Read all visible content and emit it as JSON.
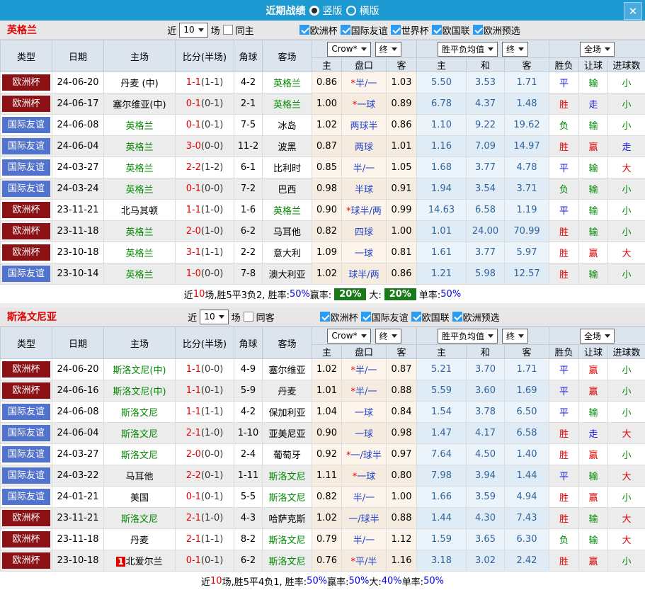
{
  "titlebar": {
    "title": "近期战绩",
    "vertical": "竖版",
    "horizontal": "横版"
  },
  "icons": {
    "close": "✕",
    "check": "✓"
  },
  "labels": {
    "near": "近",
    "matches_suffix": "场"
  },
  "table_header": {
    "cols": [
      "类型",
      "日期",
      "主场",
      "比分(半场)",
      "角球",
      "客场"
    ],
    "sub": [
      "主",
      "盘口",
      "客",
      "主",
      "和",
      "客",
      "胜负",
      "让球",
      "进球数"
    ],
    "selects": {
      "crow": "Crow*",
      "final": "终",
      "wdl": "胜平负均值",
      "final2": "终",
      "scope": "全场"
    }
  },
  "colors": {
    "titlebar_bg": "#1e9ad2",
    "type_colors": {
      "欧洲杯": "#8c1114",
      "国际友谊": "#5273cd"
    },
    "result_colors": {
      "胜": "#dd0000",
      "平": "#1515dd",
      "负": "#008800",
      "赢": "#dd0000",
      "走": "#1515dd",
      "输": "#008800",
      "大": "#dd0000",
      "小": "#008800"
    },
    "team_green": "#008800",
    "score_red": "#e60000",
    "handicap_blue": "#2244cc",
    "wdl_blue": "#31639c",
    "highlight_green": "#1a7a1a"
  },
  "sections": [
    {
      "team": "英格兰",
      "filter": {
        "matches": "10",
        "same_label": "同主",
        "leagues": [
          "欧洲杯",
          "国际友谊",
          "世界杯",
          "欧国联",
          "欧洲预选"
        ]
      },
      "rows": [
        {
          "type": "欧洲杯",
          "date": "24-06-20",
          "home": "丹麦 (中)",
          "hg": false,
          "score": "1-1",
          "half": "(1-1)",
          "corner": "4-2",
          "away": "英格兰",
          "ag": true,
          "o1": "0.86",
          "star": true,
          "hcap": "半/一",
          "o2": "1.03",
          "w": "5.50",
          "d": "3.53",
          "l": "1.71",
          "r1": "平",
          "r2": "输",
          "r3": "小"
        },
        {
          "type": "欧洲杯",
          "date": "24-06-17",
          "home": "塞尔维亚(中)",
          "hg": false,
          "score": "0-1",
          "half": "(0-1)",
          "corner": "2-1",
          "away": "英格兰",
          "ag": true,
          "o1": "1.00",
          "star": true,
          "hcap": "一球",
          "o2": "0.89",
          "w": "6.78",
          "d": "4.37",
          "l": "1.48",
          "r1": "胜",
          "r2": "走",
          "r3": "小"
        },
        {
          "type": "国际友谊",
          "date": "24-06-08",
          "home": "英格兰",
          "hg": true,
          "score": "0-1",
          "half": "(0-1)",
          "corner": "7-5",
          "away": "冰岛",
          "ag": false,
          "o1": "1.02",
          "star": false,
          "hcap": "两球半",
          "o2": "0.86",
          "w": "1.10",
          "d": "9.22",
          "l": "19.62",
          "r1": "负",
          "r2": "输",
          "r3": "小"
        },
        {
          "type": "国际友谊",
          "date": "24-06-04",
          "home": "英格兰",
          "hg": true,
          "score": "3-0",
          "half": "(0-0)",
          "corner": "11-2",
          "away": "波黑",
          "ag": false,
          "o1": "0.87",
          "star": false,
          "hcap": "两球",
          "o2": "1.01",
          "w": "1.16",
          "d": "7.09",
          "l": "14.97",
          "r1": "胜",
          "r2": "赢",
          "r3": "走"
        },
        {
          "type": "国际友谊",
          "date": "24-03-27",
          "home": "英格兰",
          "hg": true,
          "score": "2-2",
          "half": "(1-2)",
          "corner": "6-1",
          "away": "比利时",
          "ag": false,
          "o1": "0.85",
          "star": false,
          "hcap": "半/一",
          "o2": "1.05",
          "w": "1.68",
          "d": "3.77",
          "l": "4.78",
          "r1": "平",
          "r2": "输",
          "r3": "大"
        },
        {
          "type": "国际友谊",
          "date": "24-03-24",
          "home": "英格兰",
          "hg": true,
          "score": "0-1",
          "half": "(0-0)",
          "corner": "7-2",
          "away": "巴西",
          "ag": false,
          "o1": "0.98",
          "star": false,
          "hcap": "半球",
          "o2": "0.91",
          "w": "1.94",
          "d": "3.54",
          "l": "3.71",
          "r1": "负",
          "r2": "输",
          "r3": "小"
        },
        {
          "type": "欧洲杯",
          "date": "23-11-21",
          "home": "北马其顿",
          "hg": false,
          "score": "1-1",
          "half": "(1-0)",
          "corner": "1-6",
          "away": "英格兰",
          "ag": true,
          "o1": "0.90",
          "star": true,
          "hcap": "球半/两",
          "o2": "0.99",
          "w": "14.63",
          "d": "6.58",
          "l": "1.19",
          "r1": "平",
          "r2": "输",
          "r3": "小"
        },
        {
          "type": "欧洲杯",
          "date": "23-11-18",
          "home": "英格兰",
          "hg": true,
          "score": "2-0",
          "half": "(1-0)",
          "corner": "6-2",
          "away": "马耳他",
          "ag": false,
          "o1": "0.82",
          "star": false,
          "hcap": "四球",
          "o2": "1.00",
          "w": "1.01",
          "d": "24.00",
          "l": "70.99",
          "r1": "胜",
          "r2": "输",
          "r3": "小"
        },
        {
          "type": "欧洲杯",
          "date": "23-10-18",
          "home": "英格兰",
          "hg": true,
          "score": "3-1",
          "half": "(1-1)",
          "corner": "2-2",
          "away": "意大利",
          "ag": false,
          "o1": "1.09",
          "star": false,
          "hcap": "一球",
          "o2": "0.81",
          "w": "1.61",
          "d": "3.77",
          "l": "5.97",
          "r1": "胜",
          "r2": "赢",
          "r3": "大"
        },
        {
          "type": "国际友谊",
          "date": "23-10-14",
          "home": "英格兰",
          "hg": true,
          "score": "1-0",
          "half": "(0-0)",
          "corner": "7-8",
          "away": "澳大利亚",
          "ag": false,
          "o1": "1.02",
          "star": false,
          "hcap": "球半/两",
          "o2": "0.86",
          "w": "1.21",
          "d": "5.98",
          "l": "12.57",
          "r1": "胜",
          "r2": "输",
          "r3": "小"
        }
      ],
      "summary": [
        {
          "text": "近",
          "style": "plain"
        },
        {
          "text": "10",
          "style": "red"
        },
        {
          "text": "场,胜5平3负2, 胜率:",
          "style": "plain"
        },
        {
          "text": "50%",
          "style": "blue"
        },
        {
          "text": " 赢率:",
          "style": "plain"
        },
        {
          "text": "20%",
          "style": "green-box"
        },
        {
          "text": " 大:",
          "style": "plain"
        },
        {
          "text": "20%",
          "style": "green-box"
        },
        {
          "text": " 单率:",
          "style": "plain"
        },
        {
          "text": "50%",
          "style": "blue"
        }
      ]
    },
    {
      "team": "斯洛文尼亚",
      "filter": {
        "matches": "10",
        "same_label": "同客",
        "leagues": [
          "欧洲杯",
          "国际友谊",
          "欧国联",
          "欧洲预选"
        ]
      },
      "rows": [
        {
          "type": "欧洲杯",
          "date": "24-06-20",
          "home": "斯洛文尼(中)",
          "hg": true,
          "score": "1-1",
          "half": "(0-0)",
          "corner": "4-9",
          "away": "塞尔维亚",
          "ag": false,
          "o1": "1.02",
          "star": true,
          "hcap": "半/一",
          "o2": "0.87",
          "w": "5.21",
          "d": "3.70",
          "l": "1.71",
          "r1": "平",
          "r2": "赢",
          "r3": "小"
        },
        {
          "type": "欧洲杯",
          "date": "24-06-16",
          "home": "斯洛文尼(中)",
          "hg": true,
          "score": "1-1",
          "half": "(0-1)",
          "corner": "5-9",
          "away": "丹麦",
          "ag": false,
          "o1": "1.01",
          "star": true,
          "hcap": "半/一",
          "o2": "0.88",
          "w": "5.59",
          "d": "3.60",
          "l": "1.69",
          "r1": "平",
          "r2": "赢",
          "r3": "小"
        },
        {
          "type": "国际友谊",
          "date": "24-06-08",
          "home": "斯洛文尼",
          "hg": true,
          "score": "1-1",
          "half": "(1-1)",
          "corner": "4-2",
          "away": "保加利亚",
          "ag": false,
          "o1": "1.04",
          "star": false,
          "hcap": "一球",
          "o2": "0.84",
          "w": "1.54",
          "d": "3.78",
          "l": "6.50",
          "r1": "平",
          "r2": "输",
          "r3": "小"
        },
        {
          "type": "国际友谊",
          "date": "24-06-04",
          "home": "斯洛文尼",
          "hg": true,
          "score": "2-1",
          "half": "(1-0)",
          "corner": "1-10",
          "away": "亚美尼亚",
          "ag": false,
          "o1": "0.90",
          "star": false,
          "hcap": "一球",
          "o2": "0.98",
          "w": "1.47",
          "d": "4.17",
          "l": "6.58",
          "r1": "胜",
          "r2": "走",
          "r3": "大"
        },
        {
          "type": "国际友谊",
          "date": "24-03-27",
          "home": "斯洛文尼",
          "hg": true,
          "score": "2-0",
          "half": "(0-0)",
          "corner": "2-4",
          "away": "葡萄牙",
          "ag": false,
          "o1": "0.92",
          "star": true,
          "hcap": "一/球半",
          "o2": "0.97",
          "w": "7.64",
          "d": "4.50",
          "l": "1.40",
          "r1": "胜",
          "r2": "赢",
          "r3": "小"
        },
        {
          "type": "国际友谊",
          "date": "24-03-22",
          "home": "马耳他",
          "hg": false,
          "score": "2-2",
          "half": "(0-1)",
          "corner": "1-11",
          "away": "斯洛文尼",
          "ag": true,
          "o1": "1.11",
          "star": true,
          "hcap": "一球",
          "o2": "0.80",
          "w": "7.98",
          "d": "3.94",
          "l": "1.44",
          "r1": "平",
          "r2": "输",
          "r3": "大"
        },
        {
          "type": "国际友谊",
          "date": "24-01-21",
          "home": "美国",
          "hg": false,
          "score": "0-1",
          "half": "(0-1)",
          "corner": "5-5",
          "away": "斯洛文尼",
          "ag": true,
          "o1": "0.82",
          "star": false,
          "hcap": "半/一",
          "o2": "1.00",
          "w": "1.66",
          "d": "3.59",
          "l": "4.94",
          "r1": "胜",
          "r2": "赢",
          "r3": "小"
        },
        {
          "type": "欧洲杯",
          "date": "23-11-21",
          "home": "斯洛文尼",
          "hg": true,
          "score": "2-1",
          "half": "(1-0)",
          "corner": "4-3",
          "away": "哈萨克斯",
          "ag": false,
          "o1": "1.02",
          "star": false,
          "hcap": "一/球半",
          "o2": "0.88",
          "w": "1.44",
          "d": "4.30",
          "l": "7.43",
          "r1": "胜",
          "r2": "输",
          "r3": "大"
        },
        {
          "type": "欧洲杯",
          "date": "23-11-18",
          "home": "丹麦",
          "hg": false,
          "score": "2-1",
          "half": "(1-1)",
          "corner": "8-2",
          "away": "斯洛文尼",
          "ag": true,
          "o1": "0.79",
          "star": false,
          "hcap": "半/一",
          "o2": "1.12",
          "w": "1.59",
          "d": "3.65",
          "l": "6.30",
          "r1": "负",
          "r2": "输",
          "r3": "大"
        },
        {
          "type": "欧洲杯",
          "date": "23-10-18",
          "home": "北爱尔兰",
          "hbadge": "1",
          "hg": false,
          "score": "0-1",
          "half": "(0-1)",
          "corner": "6-2",
          "away": "斯洛文尼",
          "ag": true,
          "o1": "0.76",
          "star": true,
          "hcap": "平/半",
          "o2": "1.16",
          "w": "3.18",
          "d": "3.02",
          "l": "2.42",
          "r1": "胜",
          "r2": "赢",
          "r3": "小"
        }
      ],
      "summary": [
        {
          "text": "近",
          "style": "plain"
        },
        {
          "text": "10",
          "style": "red"
        },
        {
          "text": "场,胜5平4负1, 胜率:",
          "style": "plain"
        },
        {
          "text": "50%",
          "style": "blue"
        },
        {
          "text": " 赢率:",
          "style": "plain"
        },
        {
          "text": "50%",
          "style": "blue"
        },
        {
          "text": " 大:",
          "style": "plain"
        },
        {
          "text": "40%",
          "style": "blue"
        },
        {
          "text": " 单率:",
          "style": "plain"
        },
        {
          "text": "50%",
          "style": "blue"
        }
      ]
    }
  ]
}
